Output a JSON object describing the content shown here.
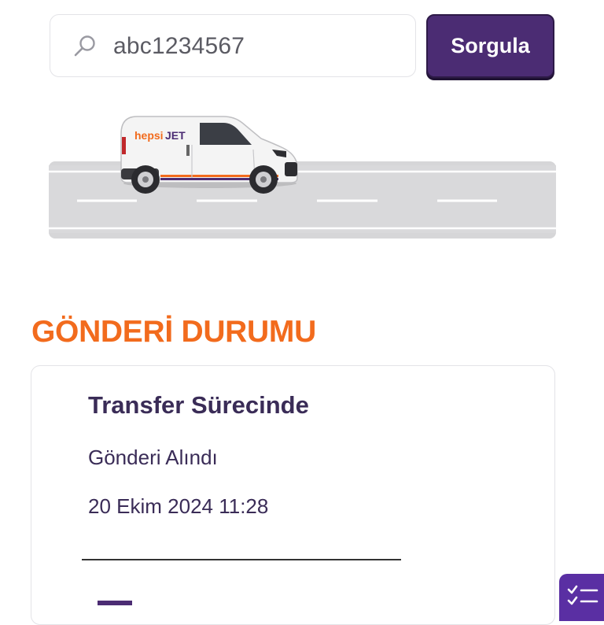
{
  "search": {
    "value": "abc1234567",
    "button_label": "Sorgula"
  },
  "illustration": {
    "brand_text_part1": "hepsi",
    "brand_text_part2": "JET"
  },
  "status": {
    "section_title": "GÖNDERİ DURUMU",
    "card": {
      "heading": "Transfer Sürecinde",
      "event": "Gönderi Alındı",
      "date": "20 Ekim 2024 11:28"
    }
  },
  "colors": {
    "primary_purple": "#4b2c73",
    "accent_orange": "#f26b1d",
    "text_dark_purple": "#3a2c57"
  },
  "icons": {
    "search": "search-icon",
    "fab": "checklist-icon"
  }
}
